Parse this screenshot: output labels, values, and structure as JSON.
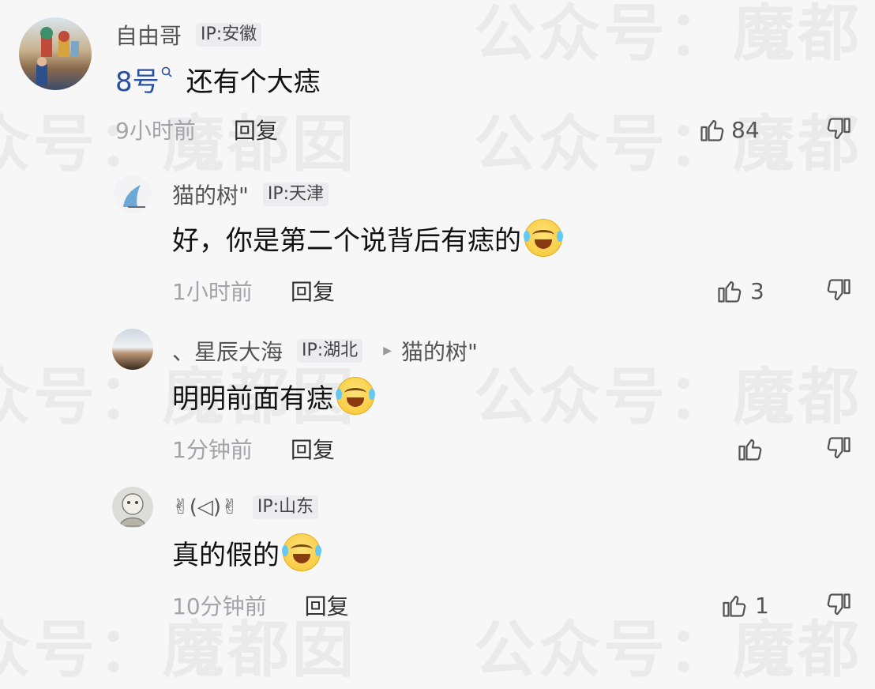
{
  "watermark": {
    "texts": [
      "众号：魔都囡",
      "公众号：魔都",
      "众号：魔都囡",
      "公众号：魔都"
    ]
  },
  "comments": [
    {
      "username": "自由哥",
      "ip": "IP:安徽",
      "content": "8号",
      "content_suffix": "还有个大痣",
      "time": "9小时前",
      "reply_label": "回复",
      "like_count": "84"
    },
    {
      "username": "猫的树\"",
      "ip": "IP:天津",
      "content": "好，你是第二个说背后有痣的",
      "time": "1小时前",
      "reply_label": "回复",
      "like_count": "3"
    },
    {
      "username": "、星辰大海",
      "ip": "IP:湖北",
      "reply_to": "猫的树\"",
      "content": "明明前面有痣",
      "time": "1分钟前",
      "reply_label": "回复",
      "like_count": ""
    },
    {
      "username": "✌(◁)✌",
      "ip": "IP:山东",
      "content": "真的假的",
      "time": "10分钟前",
      "reply_label": "回复",
      "like_count": "1"
    }
  ],
  "icons": {
    "like": "thumbs-up-icon",
    "dislike": "thumbs-down-icon",
    "search": "search-icon",
    "emoji": "laugh-cry-emoji-icon",
    "reply_arrow": "triangle-right-icon"
  }
}
